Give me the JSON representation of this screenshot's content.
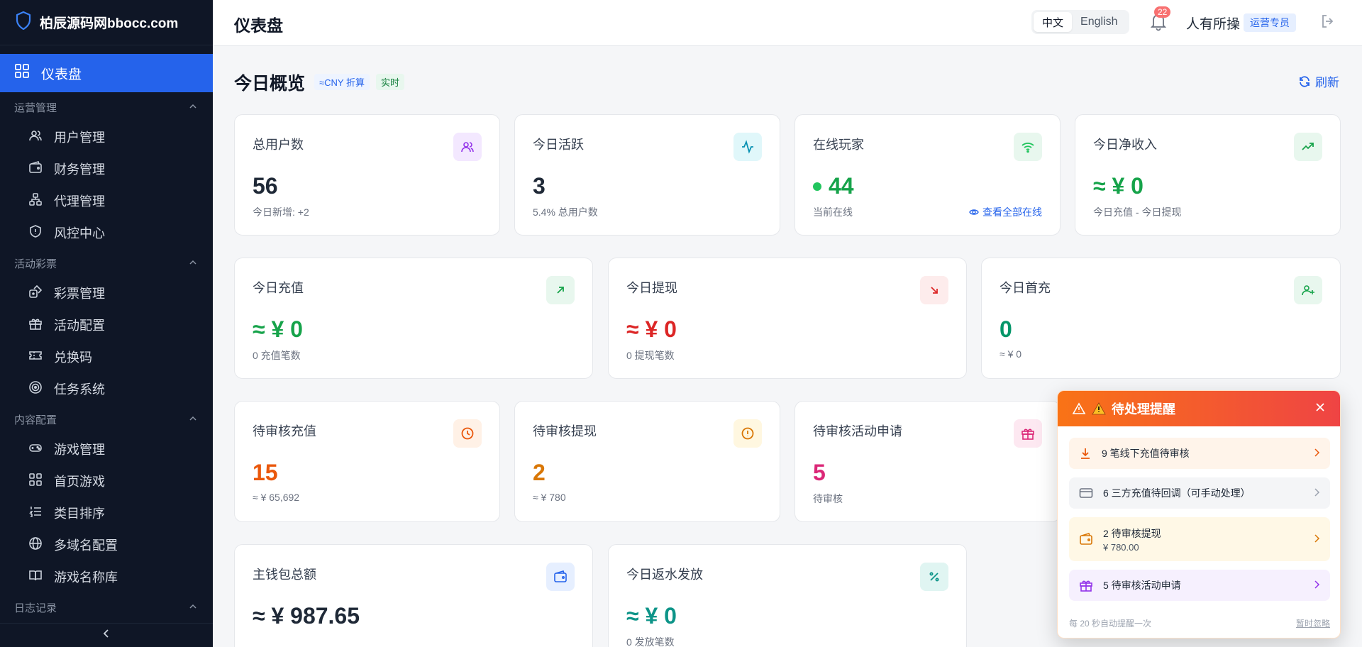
{
  "brand": {
    "name": "柏辰源码网bbocc.com"
  },
  "sidebar": {
    "active": {
      "label": "仪表盘"
    },
    "sections": [
      {
        "title": "运营管理",
        "items": [
          "用户管理",
          "财务管理",
          "代理管理",
          "风控中心"
        ]
      },
      {
        "title": "活动彩票",
        "items": [
          "彩票管理",
          "活动配置",
          "兑换码",
          "任务系统"
        ]
      },
      {
        "title": "内容配置",
        "items": [
          "游戏管理",
          "首页游戏",
          "类目排序",
          "多域名配置",
          "游戏名称库"
        ]
      },
      {
        "title": "日志记录",
        "items": []
      }
    ]
  },
  "header": {
    "title": "仪表盘",
    "lang_zh": "中文",
    "lang_en": "English",
    "notification_count": "22",
    "user_name": "人有所操",
    "role": "运营专员"
  },
  "overview": {
    "title": "今日概览",
    "tag_cny": "≈CNY 折算",
    "tag_live": "实时",
    "refresh": "刷新"
  },
  "cards": {
    "total_users": {
      "label": "总用户数",
      "value": "56",
      "sub": "今日新增: +2"
    },
    "active_today": {
      "label": "今日活跃",
      "value": "3",
      "sub": "5.4% 总用户数"
    },
    "online_players": {
      "label": "在线玩家",
      "value": "44",
      "sub": "当前在线",
      "link": "查看全部在线"
    },
    "net_income": {
      "label": "今日净收入",
      "value": "≈ ¥ 0",
      "sub": "今日充值 - 今日提现"
    },
    "recharge_today": {
      "label": "今日充值",
      "value": "≈ ¥ 0",
      "sub": "0 充值笔数"
    },
    "withdraw_today": {
      "label": "今日提现",
      "value": "≈ ¥ 0",
      "sub": "0 提现笔数"
    },
    "first_recharge": {
      "label": "今日首充",
      "value": "0",
      "sub": "≈ ¥ 0"
    },
    "pending_recharge": {
      "label": "待审核充值",
      "value": "15",
      "sub": "≈ ¥ 65,692"
    },
    "pending_withdraw": {
      "label": "待审核提现",
      "value": "2",
      "sub": "≈ ¥ 780"
    },
    "pending_activity": {
      "label": "待审核活动申请",
      "value": "5",
      "sub": "待审核"
    },
    "main_wallet": {
      "label": "主钱包总额",
      "value": "≈ ¥ 987.65"
    },
    "rebate_today": {
      "label": "今日返水发放",
      "value": "≈ ¥ 0",
      "sub": "0 发放笔数"
    }
  },
  "popup": {
    "title": "待处理提醒",
    "items": [
      {
        "text": "9 笔线下充值待审核"
      },
      {
        "text": "6 三方充值待回调（可手动处理）"
      },
      {
        "text": "2 待审核提现",
        "sub": "¥ 780.00"
      },
      {
        "text": "5 待审核活动申请"
      }
    ],
    "footer_note": "每 20 秒自动提醒一次",
    "dismiss": "暂时忽略"
  },
  "colors": {
    "primary": "#2563eb",
    "sidebar_bg": "#0f1626",
    "positive": "#16a34a",
    "negative": "#dc2626",
    "warning": "#ea580c"
  }
}
